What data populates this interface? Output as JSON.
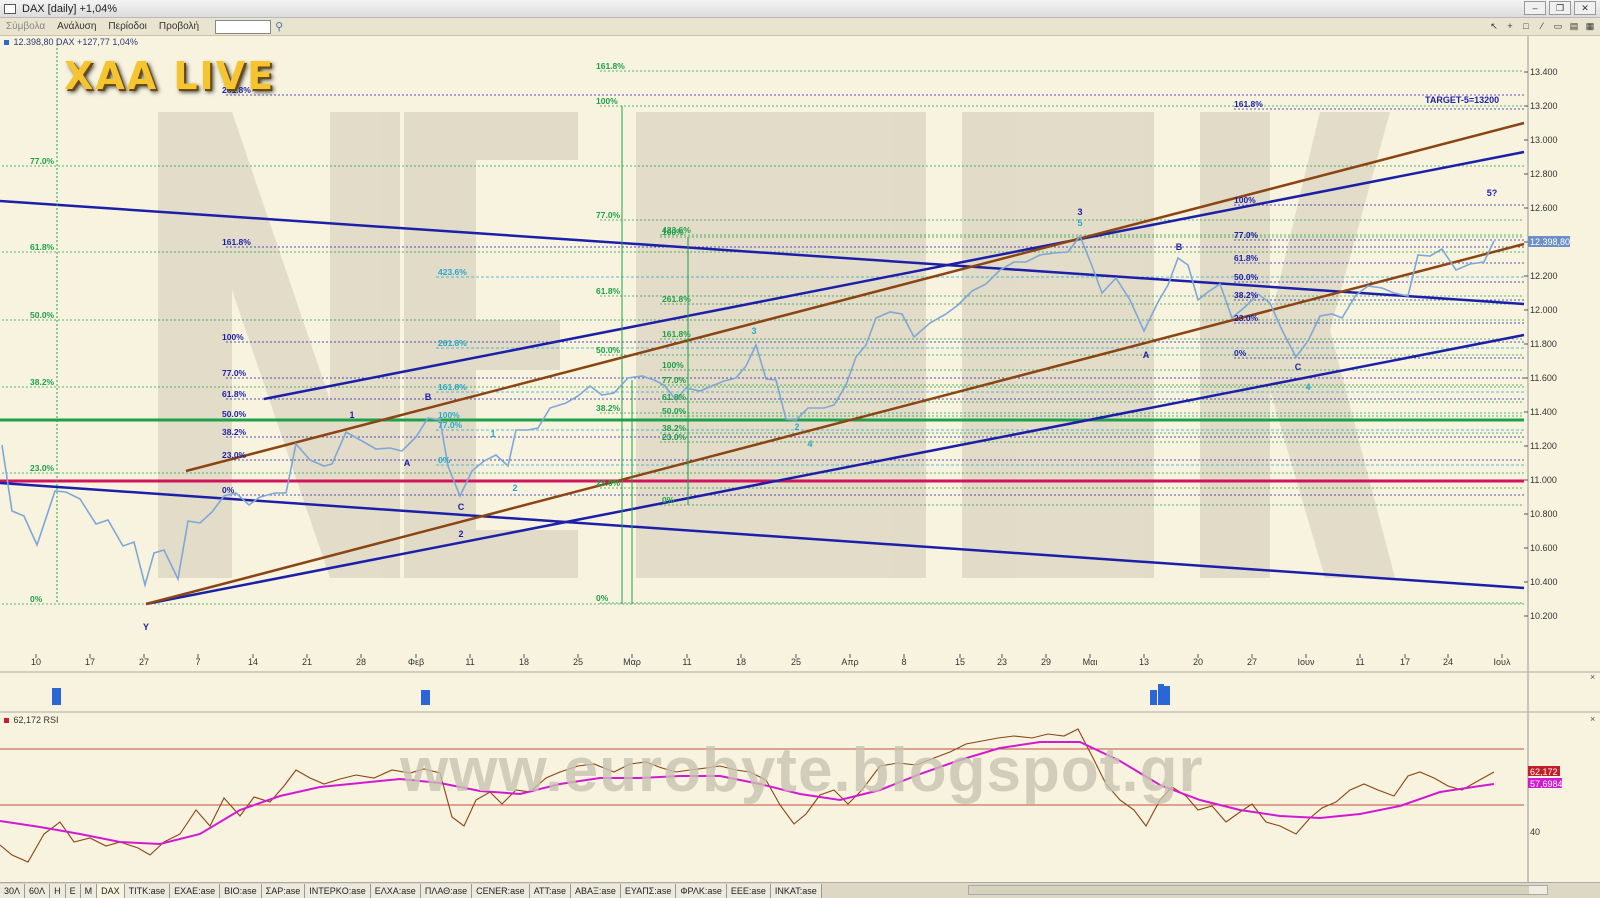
{
  "window": {
    "title": "DAX [daily] +1,04%",
    "controls": [
      "–",
      "❐",
      "✕"
    ]
  },
  "menu": {
    "items": [
      "Σύμβολα",
      "Ανάλυση",
      "Περίοδοι",
      "Προβολή"
    ],
    "symbol_value": ""
  },
  "toolbar_right": [
    "↖",
    "+",
    "□",
    "⁄",
    "▭",
    "▤",
    "▦"
  ],
  "price_legend": "12.398,80 DAX +127,77 1,04%",
  "logo_text": "XAA LIVE",
  "watermark": "www.eurobyte.blogspot.gr",
  "target_label": "TARGET-5=13200",
  "price_axis": [
    "13.400",
    "13.200",
    "13.000",
    "12.800",
    "12.600",
    "12.400",
    "12.200",
    "12.000",
    "11.800",
    "11.600",
    "11.400",
    "11.200",
    "11.000",
    "10.800",
    "10.600",
    "10.400",
    "10.200"
  ],
  "last_price_tag": "12.398,80",
  "date_axis": [
    "10",
    "17",
    "27",
    "7",
    "14",
    "21",
    "28",
    "Φεβ",
    "11",
    "18",
    "25",
    "Μαρ",
    "11",
    "18",
    "25",
    "Απρ",
    "8",
    "15",
    "23",
    "29",
    "Μαι",
    "13",
    "20",
    "27",
    "Ιουν",
    "11",
    "17",
    "24",
    "Ιουλ"
  ],
  "rsi_legend": "62,172 RSI",
  "rsi_tags": {
    "rsi": "62,172",
    "signal": "57,6984",
    "level": "40"
  },
  "fib_left": [
    "77.0%",
    "61.8%",
    "50.0%",
    "38.2%",
    "23.0%",
    "0%"
  ],
  "fib_top_green": [
    "161.8%",
    "100%",
    "77.0%",
    "61.8%",
    "50.0%",
    "38.2%",
    "23.0%",
    "0%"
  ],
  "fib_upper_left": [
    "261.8%",
    "161.8%",
    "100%",
    "77.0%",
    "61.8%",
    "50.0%",
    "38.2%",
    "23.0%",
    "0%"
  ],
  "fib_mid_cyan": [
    "423.6%",
    "261.8%",
    "161.8%",
    "100%",
    "77.0%",
    "0%"
  ],
  "fib_mid2": [
    "100%",
    "423.6%",
    "261.8%",
    "161.8%",
    "100%",
    "77.0%",
    "61.8%",
    "50.0%",
    "38.2%",
    "23.0%",
    "0%"
  ],
  "fib_right": [
    "161.8%",
    "100%",
    "77.0%",
    "61.8%",
    "50.0%",
    "38.2%",
    "23.0%",
    "0%"
  ],
  "wave_labels": [
    "Y",
    "1",
    "A",
    "B",
    "C",
    "1",
    "2",
    "2",
    "3",
    "4",
    "2",
    "3",
    "5",
    "A",
    "B",
    "C",
    "4",
    "5?"
  ],
  "bottom_tabs": [
    "30Λ",
    "60Λ",
    "H",
    "E",
    "M",
    "DAX",
    "TITK:ase",
    "EXAE:ase",
    "BIO:ase",
    "ΣΑΡ:ase",
    "INTEPKO:ase",
    "ΕΛΧΑ:ase",
    "ΠΛΑΘ:ase",
    "CENER:ase",
    "ATT:ase",
    "ΑΒΑΞ:ase",
    "ΕΥΑΠΣ:ase",
    "ΦΡΛΚ:ase",
    "EEE:ase",
    "INKAT:ase"
  ],
  "colors": {
    "background": "#f7f3df",
    "price_line": "#7fa8d6",
    "channel_blue": "#1c1fa8",
    "channel_brown": "#8b4513",
    "fib_green": "#1fa04a",
    "fib_cyan": "#27a9c9",
    "red_line": "#d0155d",
    "rsi_line": "#8b4513",
    "rsi_signal": "#d21ad2"
  }
}
